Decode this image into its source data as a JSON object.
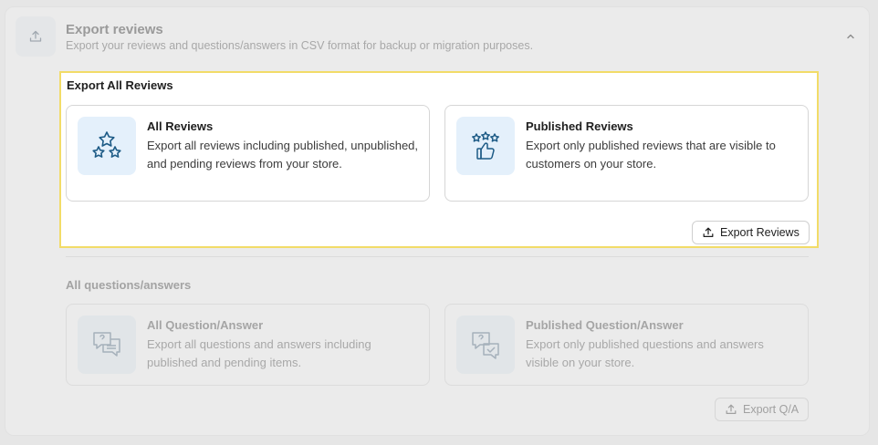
{
  "header": {
    "title": "Export reviews",
    "description": "Export your reviews and questions/answers in CSV format for backup or migration purposes."
  },
  "reviews_section": {
    "title": "Export All Reviews",
    "cards": [
      {
        "title": "All Reviews",
        "description": "Export all reviews including published, unpublished, and pending reviews from your store.",
        "icon": "stars-icon"
      },
      {
        "title": "Published Reviews",
        "description": "Export only published reviews that are visible to customers on your store.",
        "icon": "thumbs-up-stars-icon"
      }
    ],
    "button_label": "Export Reviews"
  },
  "qa_section": {
    "title": "All questions/answers",
    "cards": [
      {
        "title": "All Question/Answer",
        "description": "Export all questions and answers including published and pending items.",
        "icon": "chat-bubbles-icon"
      },
      {
        "title": "Published Question/Answer",
        "description": "Export only published questions and answers visible on your store.",
        "icon": "chat-check-icon"
      }
    ],
    "button_label": "Export Q/A"
  },
  "colors": {
    "highlight_border": "#f2dc68",
    "icon_blue": "#1d5b86",
    "icon_bg": "#e4f0fb"
  }
}
